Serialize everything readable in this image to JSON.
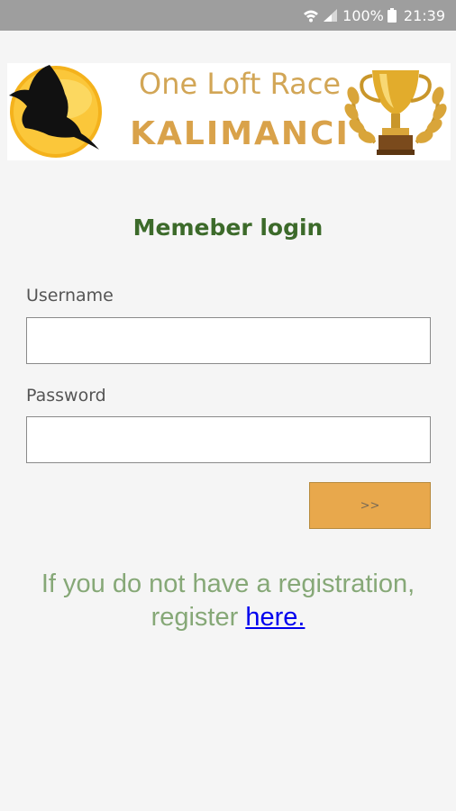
{
  "status_bar": {
    "battery": "100%",
    "time": "21:39",
    "icons": [
      "wifi-icon",
      "signal-icon",
      "battery-icon"
    ]
  },
  "banner": {
    "line1": "One Loft Race",
    "line2": "KALIMANCI",
    "logo_icon": "pigeon-logo-icon",
    "trophy_icon": "trophy-icon"
  },
  "login": {
    "title": "Memeber login",
    "username_label": "Username",
    "username_value": "",
    "password_label": "Password",
    "password_value": "",
    "submit_label": ">>"
  },
  "register": {
    "line1": "If you do not have a registration,",
    "prefix": "register ",
    "link_text": "here."
  },
  "colors": {
    "status_bar": "#9e9e9e",
    "title_green": "#3c6a2a",
    "register_text": "#86a877",
    "button_orange": "#e8a84c",
    "banner_gold": "#d2a656",
    "link_blue": "#0000ee"
  }
}
